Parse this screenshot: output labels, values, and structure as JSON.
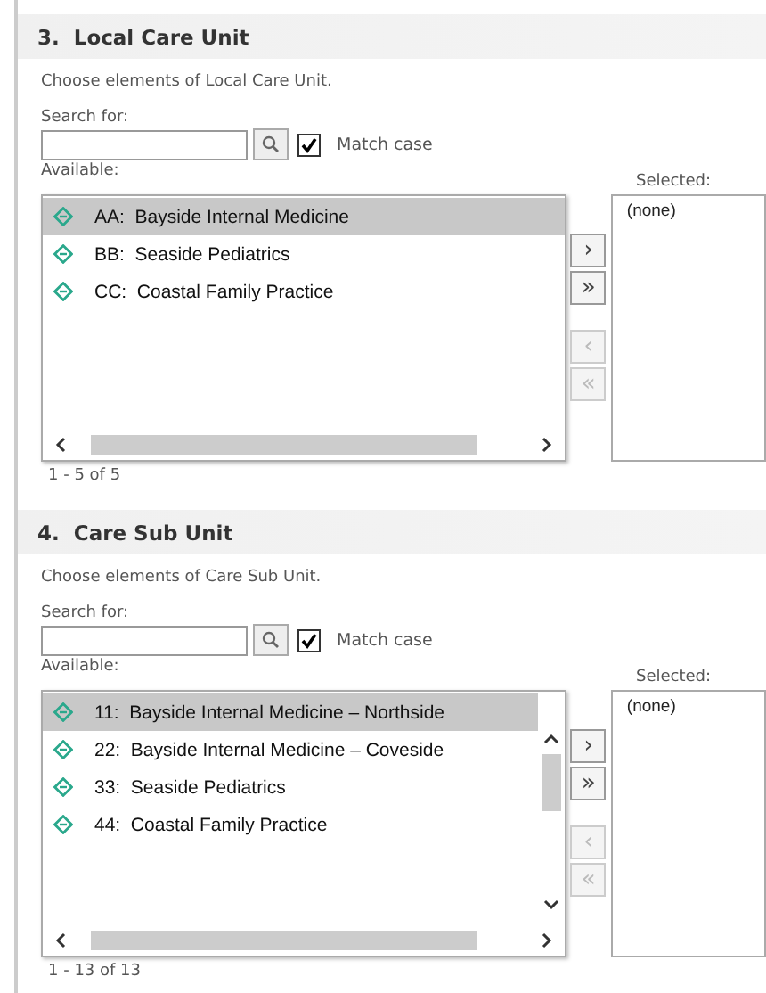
{
  "sections": [
    {
      "title": "3.  Local Care Unit",
      "description": "Choose elements of Local Care Unit.",
      "search_label": "Search for:",
      "match_case": {
        "label": "Match case",
        "checked": true
      },
      "available_label": "Available:",
      "selected_label": "Selected:",
      "vertical_scrollbar": false,
      "available": [
        {
          "label": "AA:  Bayside Internal Medicine",
          "selected": true
        },
        {
          "label": "BB:  Seaside Pediatrics",
          "selected": false
        },
        {
          "label": "CC:  Coastal Family Practice",
          "selected": false
        }
      ],
      "chosen": [
        "(none)"
      ],
      "buttons": [
        {
          "label": "›",
          "disabled": false
        },
        {
          "label": "»",
          "disabled": false
        },
        {
          "label": "‹",
          "disabled": true
        },
        {
          "label": "«",
          "disabled": true
        }
      ],
      "pager": "1 - 5 of 5"
    },
    {
      "title": "4.  Care Sub Unit",
      "description": "Choose elements of Care Sub Unit.",
      "search_label": "Search for:",
      "match_case": {
        "label": "Match case",
        "checked": true
      },
      "available_label": "Available:",
      "selected_label": "Selected:",
      "vertical_scrollbar": true,
      "available": [
        {
          "label": "11:  Bayside Internal Medicine – Northside",
          "selected": true
        },
        {
          "label": "22:  Bayside Internal Medicine – Coveside",
          "selected": false
        },
        {
          "label": "33:  Seaside Pediatrics",
          "selected": false
        },
        {
          "label": "44:  Coastal Family Practice",
          "selected": false
        }
      ],
      "chosen": [
        "(none)"
      ],
      "buttons": [
        {
          "label": "›",
          "disabled": false
        },
        {
          "label": "»",
          "disabled": false
        },
        {
          "label": "‹",
          "disabled": true
        },
        {
          "label": "«",
          "disabled": true
        }
      ],
      "pager": "1 - 13 of 13"
    }
  ]
}
